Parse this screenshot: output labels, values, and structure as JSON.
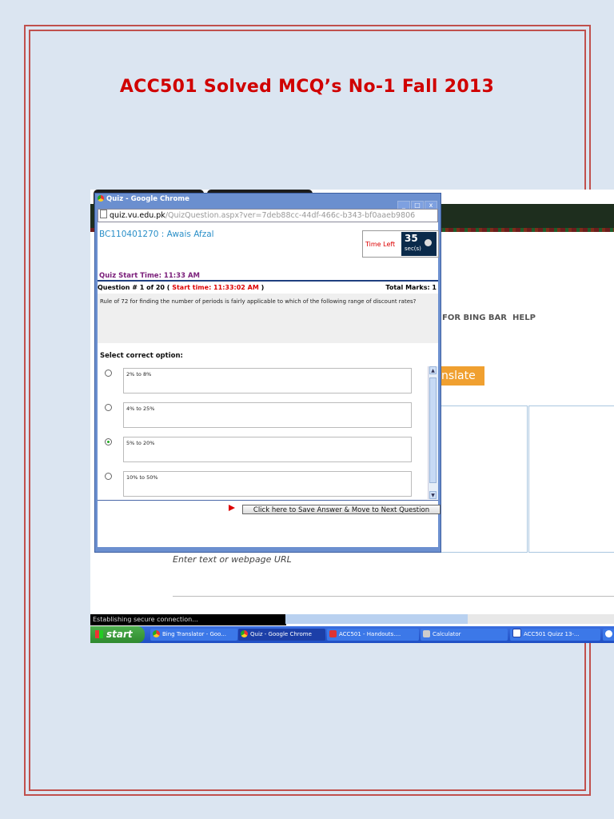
{
  "document": {
    "title": "ACC501 Solved MCQ’s No-1 Fall 2013"
  },
  "popup": {
    "window_title": "Quiz - Google Chrome",
    "url_host": "quiz.vu.edu.pk",
    "url_path": "/QuizQuestion.aspx?ver=7deb88cc-44df-466c-b343-bf0aaeb9806",
    "student": "BC110401270 : Awais Afzal",
    "time_left_label": "Time Left",
    "time_left_value": "35",
    "time_left_unit": "sec(s)",
    "quiz_start": "Quiz Start Time: 11:33 AM",
    "question_prefix": "Question # 1 of 20 (",
    "question_start": "Start time: 11:33:02 AM",
    "question_suffix": ")",
    "total_marks": "Total Marks: 1",
    "question_text": "Rule of 72 for finding the number of periods is fairly applicable to which of the following range of discount rates?",
    "select_label": "Select correct option:",
    "options": [
      {
        "label": "2% to 8%",
        "selected": false
      },
      {
        "label": "4% to 25%",
        "selected": false
      },
      {
        "label": "5% to 20%",
        "selected": true
      },
      {
        "label": "10% to 50%",
        "selected": false
      }
    ],
    "save_button": "Click here to Save Answer & Move to Next Question"
  },
  "background_page": {
    "nav_bing_bar": "FOR BING BAR",
    "nav_help": "HELP",
    "translate_button": "nslate",
    "enter_text": "Enter text or webpage URL",
    "status": "Establishing secure connection..."
  },
  "taskbar": {
    "start": "start",
    "tasks": [
      "Bing Translator - Goo...",
      "Quiz - Google Chrome",
      "ACC501 - Handouts....",
      "Calculator",
      "ACC501 Quizz 13-..."
    ]
  },
  "colors": {
    "frame": "#c0504d",
    "title": "#d00000",
    "page_bg": "#dbe5f1"
  }
}
